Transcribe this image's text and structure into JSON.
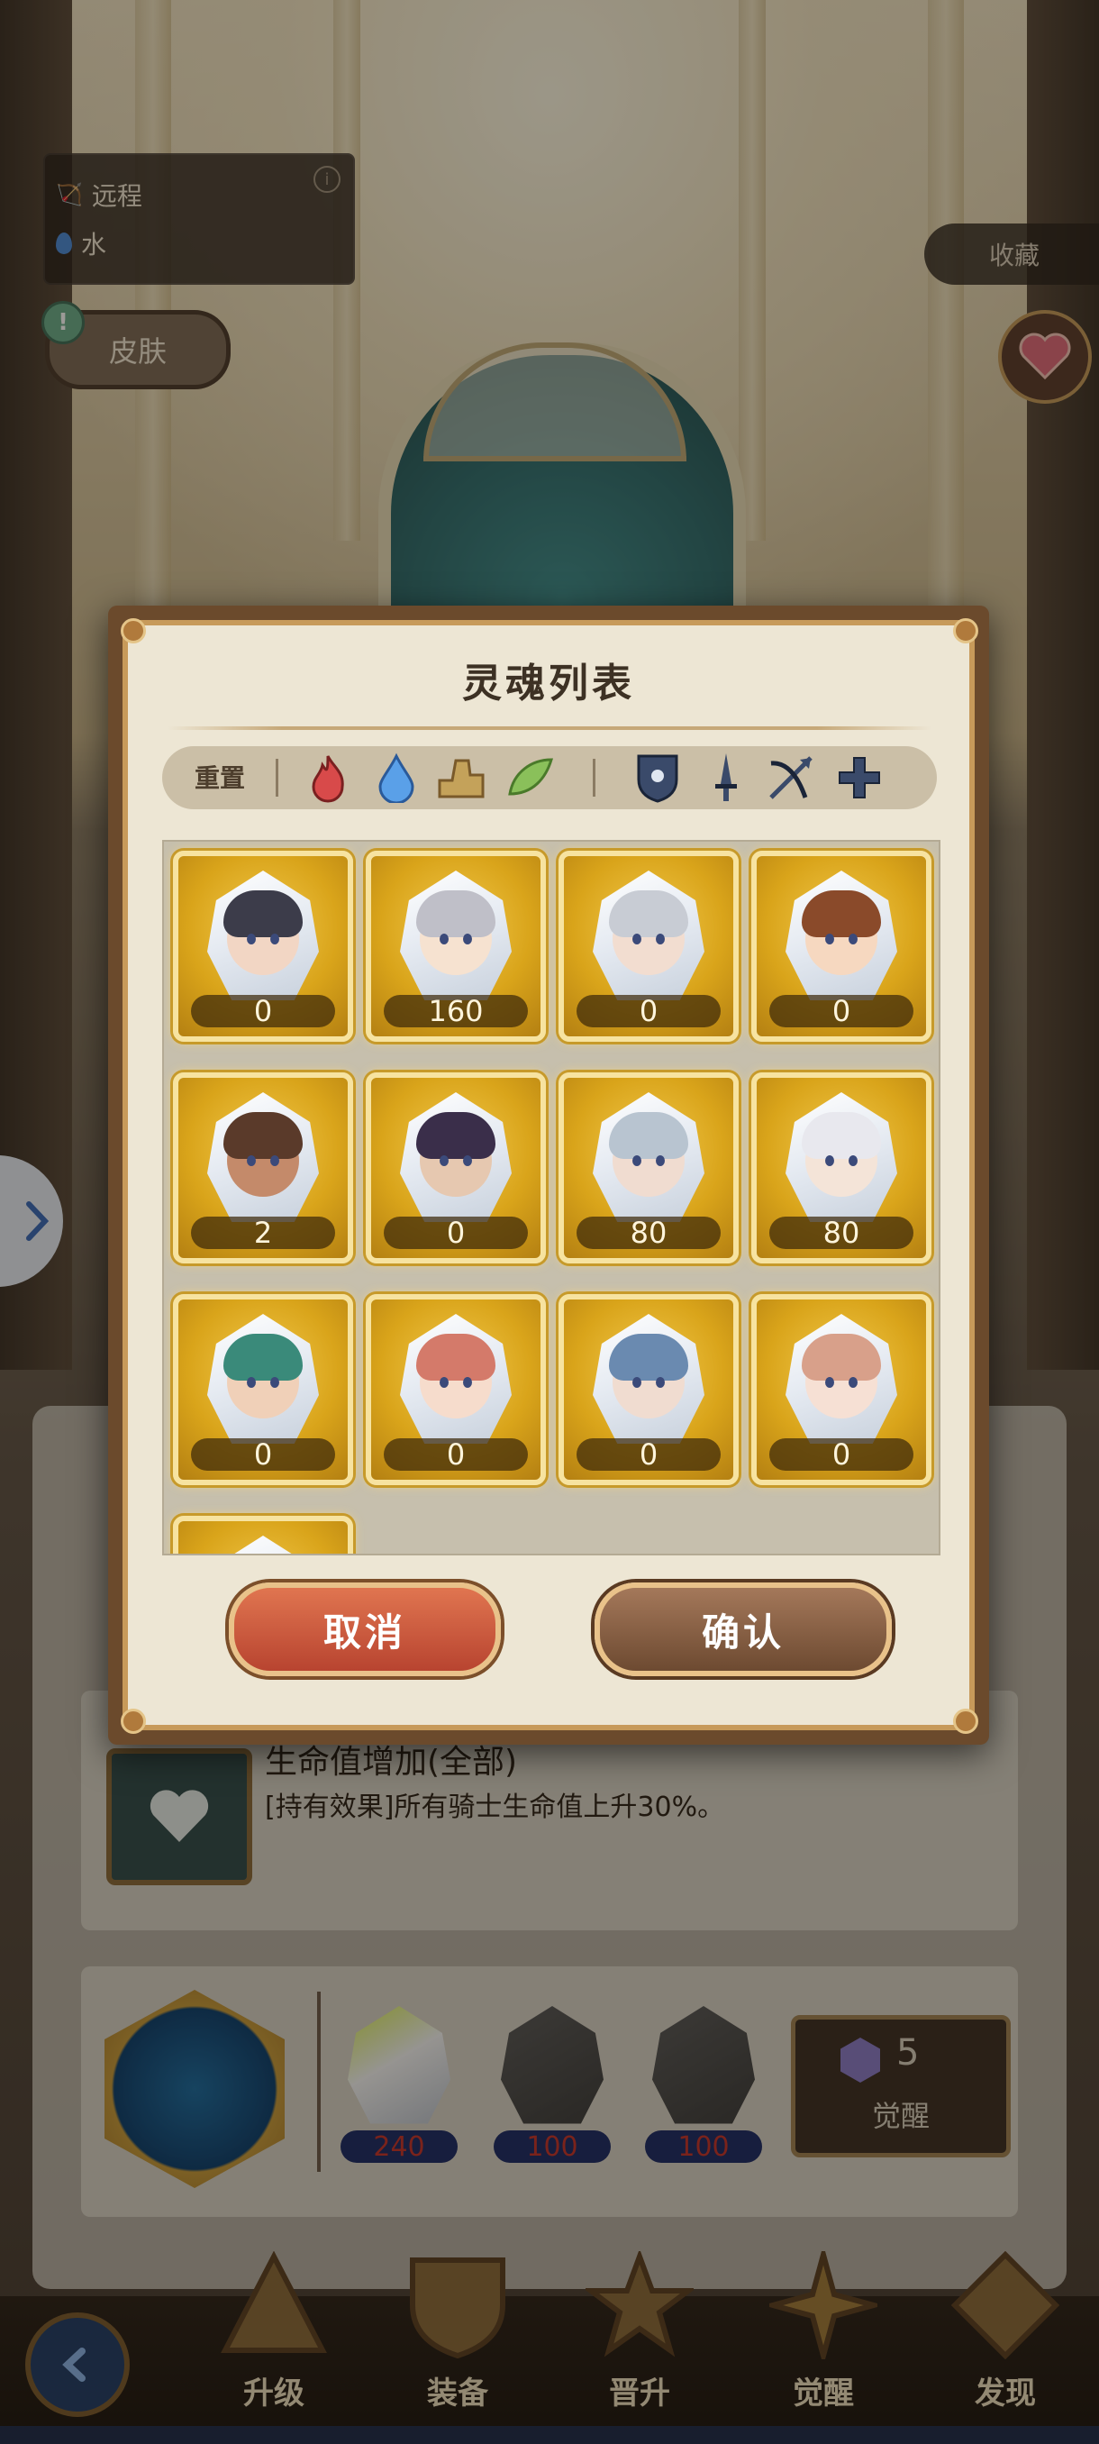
{
  "hero_info": {
    "attack_type": "远程",
    "element": "水"
  },
  "buttons": {
    "skin": "皮肤",
    "collect": "收藏"
  },
  "dialog": {
    "title": "灵魂列表",
    "filter": {
      "reset": "重置",
      "elements": [
        "fire-icon",
        "water-icon",
        "earth-icon",
        "wind-icon"
      ],
      "classes": [
        "shield-icon",
        "sword-icon",
        "bow-icon",
        "cross-icon"
      ]
    },
    "souls": [
      {
        "count": "0",
        "hair": "#3c3c4a",
        "skin": "#f2d6c4"
      },
      {
        "count": "160",
        "hair": "#bfbfc8",
        "skin": "#f6e2d0"
      },
      {
        "count": "0",
        "hair": "#c8ccd4",
        "skin": "#f2ddd0"
      },
      {
        "count": "0",
        "hair": "#8a4a2a",
        "skin": "#f6d8c0"
      },
      {
        "count": "2",
        "hair": "#5a3a2a",
        "skin": "#c48a6a"
      },
      {
        "count": "0",
        "hair": "#3a2e4a",
        "skin": "#e6c8b0"
      },
      {
        "count": "80",
        "hair": "#b8c4d0",
        "skin": "#f0dcd0"
      },
      {
        "count": "80",
        "hair": "#e8e8ee",
        "skin": "#f4e4d8"
      },
      {
        "count": "0",
        "hair": "#3a8a7a",
        "skin": "#f0d0b8"
      },
      {
        "count": "0",
        "hair": "#d47a6a",
        "skin": "#f6dccc"
      },
      {
        "count": "0",
        "hair": "#6a8ab0",
        "skin": "#f0dcd0"
      },
      {
        "count": "0",
        "hair": "#d8a08a",
        "skin": "#f6e0d4"
      },
      {
        "count": "",
        "hair": "#c8ccd4",
        "skin": "#f2ddd0"
      }
    ],
    "cancel": "取消",
    "confirm": "确认"
  },
  "effect": {
    "title": "生命值增加(全部)",
    "desc": "[持有效果]所有骑士生命值上升30%。"
  },
  "awaken": {
    "souls": [
      "240",
      "100",
      "100"
    ],
    "count": "5",
    "label": "觉醒"
  },
  "tabs": [
    "升级",
    "装备",
    "晋升",
    "觉醒",
    "发现"
  ],
  "colors": {
    "gold": "#d9a41a",
    "panel": "#ede6d4",
    "cancel": "#c4553a",
    "confirm": "#7d563a"
  }
}
